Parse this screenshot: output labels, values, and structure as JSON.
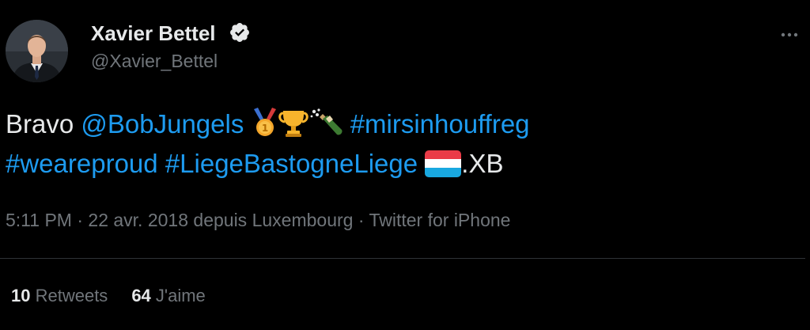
{
  "author": {
    "display_name": "Xavier Bettel",
    "handle": "@Xavier_Bettel",
    "verified": true,
    "avatar_icon": "person-avatar-icon"
  },
  "menu": {
    "more_icon": "more-horizontal-icon"
  },
  "tweet": {
    "line1": {
      "word_bravo": "Bravo ",
      "mention": "@BobJungels",
      "emojis": [
        "gold-medal-icon",
        "trophy-icon",
        "champagne-icon"
      ],
      "hashtag_1": "#mirsinhouffreg"
    },
    "line2": {
      "hashtag_2": "#weareproud",
      "space": " ",
      "hashtag_3": "#LiegeBastogneLiege",
      "flag": "luxembourg-flag-icon",
      "signature": ".XB"
    }
  },
  "meta": {
    "time": "5:11 PM",
    "separator": " · ",
    "date": "22 avr. 2018",
    "location": " depuis Luxembourg",
    "source": "Twitter for iPhone"
  },
  "stats": {
    "retweets_count": "10",
    "retweets_label": " Retweets",
    "likes_count": "64",
    "likes_label": " J'aime"
  },
  "colors": {
    "background": "#000000",
    "text": "#e7e9ea",
    "secondary": "#71767b",
    "link": "#1d9bf0",
    "divider": "#2f3336"
  }
}
